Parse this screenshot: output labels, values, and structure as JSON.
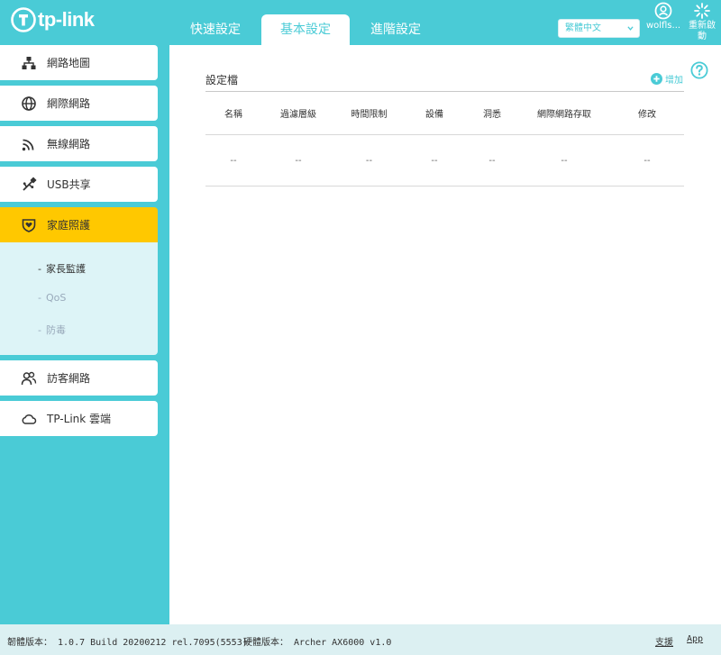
{
  "brand": {
    "name": "tp-link",
    "color": "#4acbd6"
  },
  "nav": {
    "tabs": [
      {
        "label": "快速設定"
      },
      {
        "label": "基本設定",
        "active": true
      },
      {
        "label": "進階設定"
      }
    ]
  },
  "language": {
    "selected": "繁體中文"
  },
  "user": {
    "name": "wolfls...",
    "icon": "user-icon"
  },
  "reboot": {
    "label": "重新啟動",
    "icon": "reboot-icon"
  },
  "sidebar": {
    "items": [
      {
        "label": "網路地圖",
        "icon": "network-map-icon"
      },
      {
        "label": "網際網路",
        "icon": "globe-icon"
      },
      {
        "label": "無線網路",
        "icon": "wifi-icon"
      },
      {
        "label": "USB共享",
        "icon": "usb-icon"
      },
      {
        "label": "家庭照護",
        "icon": "shield-heart-icon",
        "active": true
      },
      {
        "label": "訪客網路",
        "icon": "guest-icon"
      },
      {
        "label": "TP-Link 雲端",
        "icon": "cloud-icon"
      }
    ],
    "submenu": [
      {
        "label": "家長監護",
        "active": true
      },
      {
        "label": "QoS"
      },
      {
        "label": "防毒"
      }
    ],
    "active_color": "#ffc800",
    "submenu_bg": "#ddf4f7"
  },
  "main": {
    "section_title": "設定檔",
    "add_label": "增加",
    "table": {
      "headers": [
        "名稱",
        "過濾層級",
        "時間限制",
        "設備",
        "洞悉",
        "網際網路存取",
        "修改"
      ],
      "rows": [
        [
          "--",
          "--",
          "--",
          "--",
          "--",
          "--",
          "--"
        ]
      ]
    }
  },
  "footer": {
    "firmware": "韌體版本： 1.0.7 Build 20200212 rel.7095(5553)",
    "hardware": "硬體版本： Archer AX6000 v1.0",
    "support": "支援",
    "app": "App"
  }
}
